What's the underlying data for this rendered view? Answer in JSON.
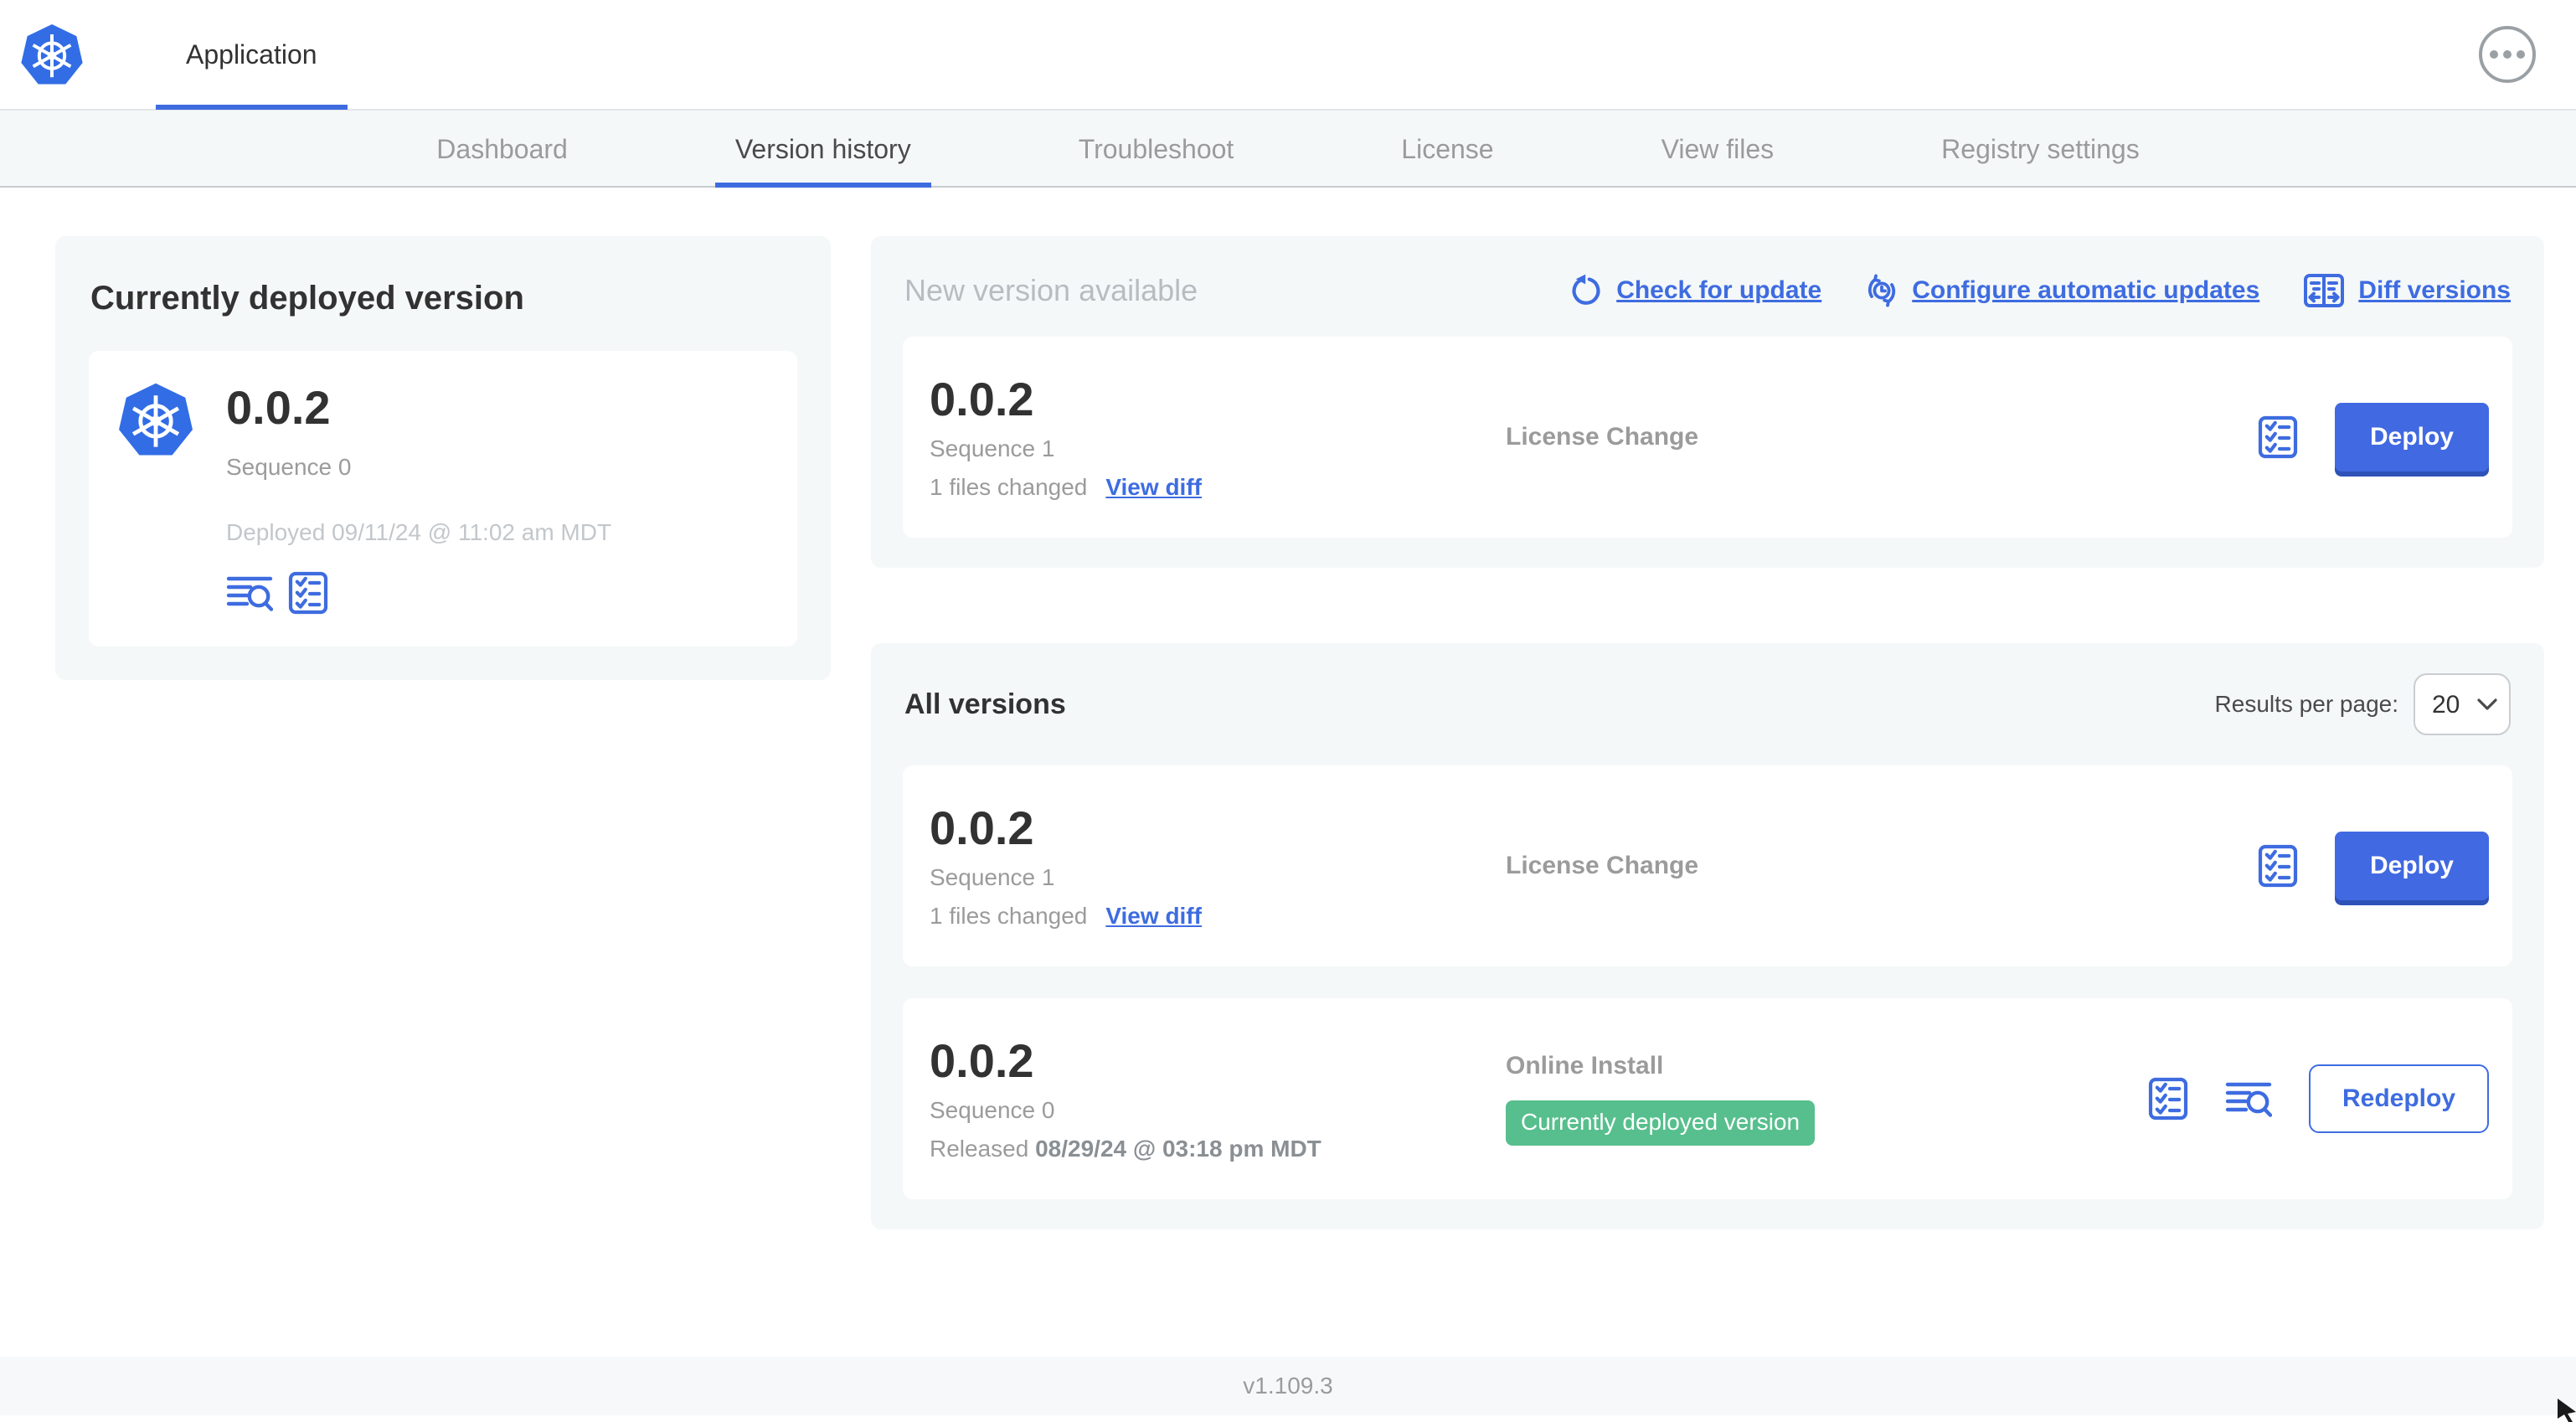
{
  "colors": {
    "accent_blue": "#3e6ce0",
    "button_blue": "#4169e1",
    "badge_green": "#57bf8d",
    "panel_bg": "#f5f8f9",
    "muted_text": "#9b9b9b"
  },
  "header": {
    "app_tab_label": "Application"
  },
  "nav": {
    "tabs": [
      {
        "label": "Dashboard"
      },
      {
        "label": "Version history"
      },
      {
        "label": "Troubleshoot"
      },
      {
        "label": "License"
      },
      {
        "label": "View files"
      },
      {
        "label": "Registry settings"
      }
    ],
    "active_tab": "Version history"
  },
  "current_version": {
    "heading": "Currently deployed version",
    "version": "0.0.2",
    "sequence": "Sequence 0",
    "deployed": "Deployed 09/11/24 @ 11:02 am MDT"
  },
  "new_version": {
    "heading": "New version available",
    "check_for_update_label": "Check for update",
    "configure_updates_label": "Configure automatic updates",
    "diff_versions_label": "Diff versions",
    "row": {
      "version": "0.0.2",
      "sequence": "Sequence 1",
      "files_changed": "1 files changed",
      "view_diff_label": "View diff",
      "source": "License Change",
      "deploy_label": "Deploy"
    }
  },
  "all_versions": {
    "heading": "All versions",
    "results_per_page_label": "Results per page:",
    "results_per_page_value": "20",
    "row1": {
      "version": "0.0.2",
      "sequence": "Sequence 1",
      "files_changed": "1 files changed",
      "view_diff_label": "View diff",
      "source": "License Change",
      "deploy_label": "Deploy"
    },
    "row2": {
      "version": "0.0.2",
      "sequence": "Sequence 0",
      "released_prefix": "Released",
      "released_date": "08/29/24 @ 03:18 pm MDT",
      "source": "Online Install",
      "badge_label": "Currently deployed version",
      "redeploy_label": "Redeploy"
    }
  },
  "footer": {
    "app_version": "v1.109.3"
  }
}
